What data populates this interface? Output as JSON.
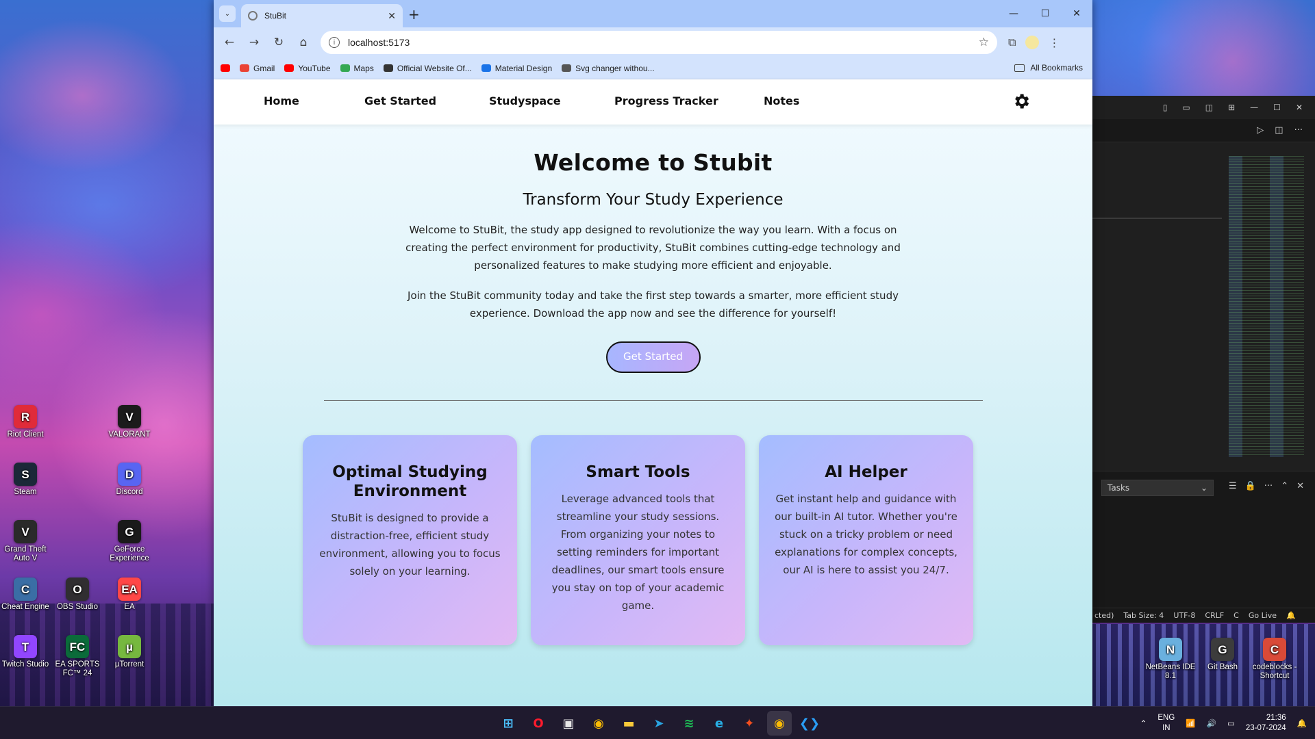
{
  "desktop": {
    "left_icons": [
      {
        "label": "Riot Client",
        "glyph": "R",
        "color": "#e02b3a"
      },
      {
        "label": "VALORANT",
        "glyph": "V",
        "color": "#1b1b1b"
      },
      {
        "label": "Steam",
        "glyph": "S",
        "color": "#1b2838"
      },
      {
        "label": "Discord",
        "glyph": "D",
        "color": "#5865f2"
      },
      {
        "label": "Grand Theft Auto V",
        "glyph": "V",
        "color": "#2a2a2a"
      },
      {
        "label": "GeForce Experience",
        "glyph": "G",
        "color": "#1a1a1a"
      },
      {
        "label": "Cheat Engine",
        "glyph": "C",
        "color": "#3a6ea5"
      },
      {
        "label": "OBS Studio",
        "glyph": "O",
        "color": "#302e31"
      },
      {
        "label": "EA",
        "glyph": "EA",
        "color": "#ff4747"
      },
      {
        "label": "Twitch Studio",
        "glyph": "T",
        "color": "#9146ff"
      },
      {
        "label": "EA SPORTS FC™ 24",
        "glyph": "FC",
        "color": "#0b6b3a"
      },
      {
        "label": "µTorrent",
        "glyph": "µ",
        "color": "#76b83f"
      }
    ],
    "right_icons": [
      {
        "label": "NetBeans IDE 8.1",
        "glyph": "N",
        "color": "#6ab0de"
      },
      {
        "label": "Git Bash",
        "glyph": "G",
        "color": "#3c3c3c"
      },
      {
        "label": "codeblocks - Shortcut",
        "glyph": "C",
        "color": "#d94a38"
      }
    ]
  },
  "browser": {
    "tab_title": "StuBit",
    "url": "localhost:5173",
    "bookmarks": [
      {
        "label": "Gmail",
        "color": "#ea4335"
      },
      {
        "label": "YouTube",
        "color": "#ff0000"
      },
      {
        "label": "Maps",
        "color": "#34a853"
      },
      {
        "label": "Official Website Of...",
        "color": "#333333"
      },
      {
        "label": "Material Design",
        "color": "#1a73e8"
      },
      {
        "label": "Svg changer withou...",
        "color": "#555555"
      }
    ],
    "all_bookmarks_label": "All Bookmarks"
  },
  "site": {
    "nav": [
      "Home",
      "Get Started",
      "Studyspace",
      "Progress Tracker",
      "Notes"
    ],
    "title": "Welcome to Stubit",
    "subtitle": "Transform Your Study Experience",
    "intro": "Welcome to StuBit, the study app designed to revolutionize the way you learn. With a focus on creating the perfect environment for productivity, StuBit combines cutting-edge technology and personalized features to make studying more efficient and enjoyable.",
    "join": "Join the StuBit community today and take the first step towards a smarter, more efficient study experience. Download the app now and see the difference for yourself!",
    "cta_label": "Get Started",
    "cards": [
      {
        "title": "Optimal Studying Environment",
        "text": "StuBit is designed to provide a distraction-free, efficient study environment, allowing you to focus solely on your learning."
      },
      {
        "title": "Smart Tools",
        "text": "Leverage advanced tools that streamline your study sessions. From organizing your notes to setting reminders for important deadlines, our smart tools ensure you stay on top of your academic game."
      },
      {
        "title": "AI Helper",
        "text": "Get instant help and guidance with our built-in AI tutor. Whether you're stuck on a tricky problem or need explanations for complex concepts, our AI is here to assist you 24/7."
      }
    ]
  },
  "vscode": {
    "tasks_label": "Tasks",
    "status": [
      "cted)",
      "Tab Size: 4",
      "UTF-8",
      "CRLF",
      "C",
      "Go Live"
    ]
  },
  "taskbar": {
    "apps": [
      {
        "name": "start",
        "glyph": "⊞",
        "color": "#4cc2ff"
      },
      {
        "name": "opera",
        "glyph": "O",
        "color": "#ff1b2d"
      },
      {
        "name": "store",
        "glyph": "▣",
        "color": "#e8e8e8"
      },
      {
        "name": "chrome",
        "glyph": "◉",
        "color": "#fbbc05"
      },
      {
        "name": "explorer",
        "glyph": "▬",
        "color": "#f8c93a"
      },
      {
        "name": "telegram",
        "glyph": "➤",
        "color": "#2aa3e0"
      },
      {
        "name": "spotify",
        "glyph": "≋",
        "color": "#1db954"
      },
      {
        "name": "edge",
        "glyph": "e",
        "color": "#28b0e6"
      },
      {
        "name": "figma",
        "glyph": "✦",
        "color": "#f24e1e"
      },
      {
        "name": "chrome-active",
        "glyph": "◉",
        "color": "#fbbc05"
      },
      {
        "name": "vscode",
        "glyph": "❮❯",
        "color": "#2a9df4"
      }
    ],
    "lang": "ENG",
    "region": "IN",
    "time": "21:36",
    "date": "23-07-2024"
  }
}
